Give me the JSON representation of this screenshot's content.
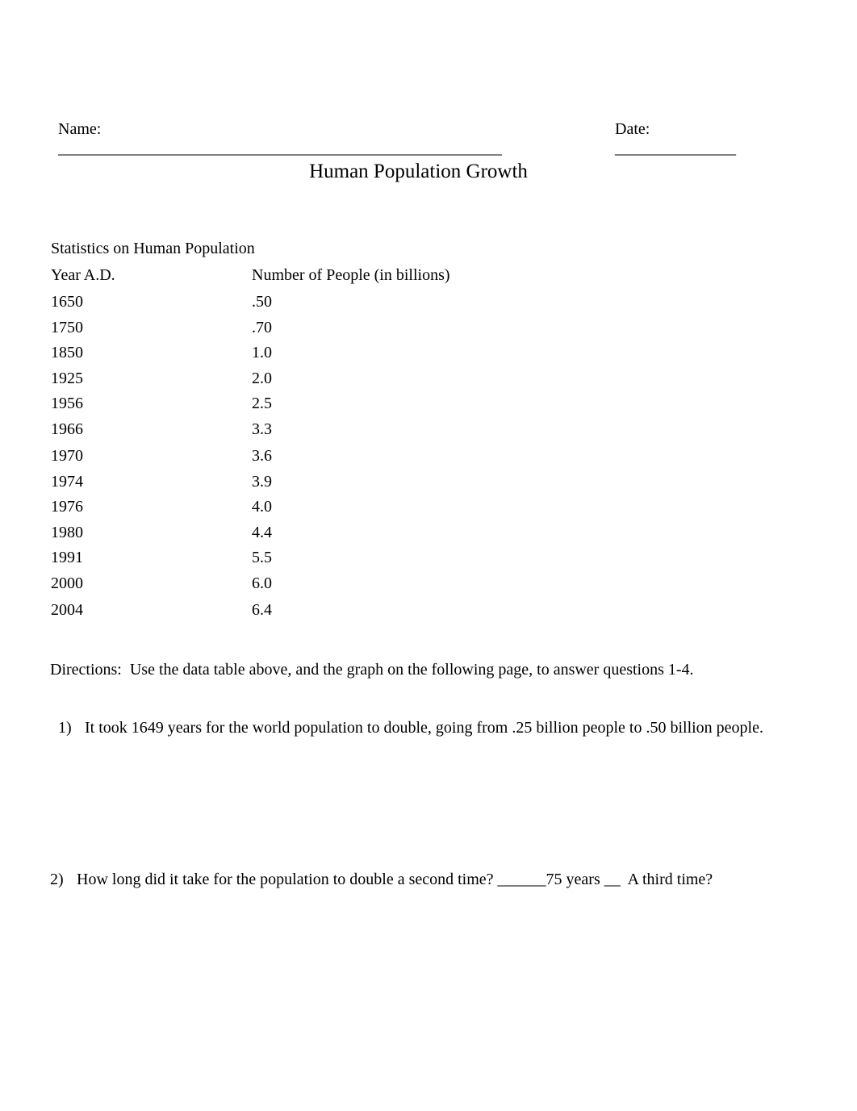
{
  "header": {
    "name_label": "Name:",
    "name_blank": "_______________________________________________________",
    "date_label": "Date:",
    "date_blank": "_______________"
  },
  "title": "Human Population Growth",
  "table": {
    "caption": "Statistics on Human Population",
    "columns": [
      "Year A.D.",
      "Number of People (in billions)"
    ],
    "rows": [
      [
        "1650",
        ".50"
      ],
      [
        "1750",
        ".70"
      ],
      [
        "1850",
        "1.0"
      ],
      [
        "1925",
        "2.0"
      ],
      [
        "1956",
        "2.5"
      ],
      [
        "1966",
        "3.3"
      ],
      [
        "1970",
        "3.6"
      ],
      [
        "1974",
        "3.9"
      ],
      [
        "1976",
        "4.0"
      ],
      [
        "1980",
        "4.4"
      ],
      [
        "1991",
        "5.5"
      ],
      [
        "2000",
        "6.0"
      ],
      [
        "2004",
        "6.4"
      ]
    ]
  },
  "directions": "Directions:  Use the data table above, and the graph on the following page, to answer questions 1-4.",
  "questions": [
    {
      "number": "1)",
      "text": "It took 1649 years for the world population to double, going from .25 billion people to .50 billion people."
    },
    {
      "number": "2)",
      "text": "How long did it take for the population to double a second time? ______75 years __  A third time?"
    }
  ]
}
